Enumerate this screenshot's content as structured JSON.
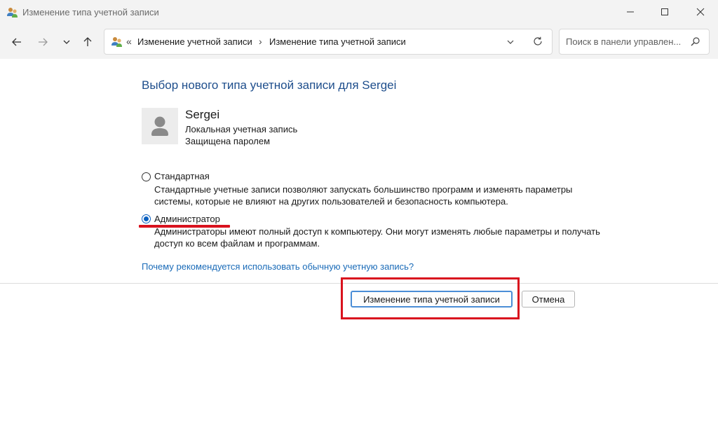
{
  "window": {
    "title": "Изменение типа учетной записи"
  },
  "navigation": {
    "breadcrumb": [
      {
        "label": "Изменение учетной записи"
      },
      {
        "label": "Изменение типа учетной записи"
      }
    ],
    "overflow_label": "«",
    "separator": "›"
  },
  "search": {
    "placeholder": "Поиск в панели управлен..."
  },
  "content": {
    "heading": "Выбор нового типа учетной записи для Sergei",
    "user": {
      "name": "Sergei",
      "type": "Локальная учетная запись",
      "status": "Защищена паролем"
    },
    "options": [
      {
        "label": "Стандартная",
        "description": "Стандартные учетные записи позволяют запускать большинство программ и изменять параметры системы, которые не влияют на других пользователей и безопасность компьютера.",
        "selected": false
      },
      {
        "label": "Администратор",
        "description": "Администраторы имеют полный доступ к компьютеру. Они могут изменять любые параметры и получать доступ ко всем файлам и программам.",
        "selected": true
      }
    ],
    "help_link": "Почему рекомендуется использовать обычную учетную запись?"
  },
  "actions": {
    "primary_label": "Изменение типа учетной записи",
    "cancel_label": "Отмена"
  },
  "colors": {
    "heading": "#1e4e8c",
    "link": "#1a6bb8",
    "annotation_red": "#d9121e",
    "radio_selected": "#0a5fbf"
  }
}
